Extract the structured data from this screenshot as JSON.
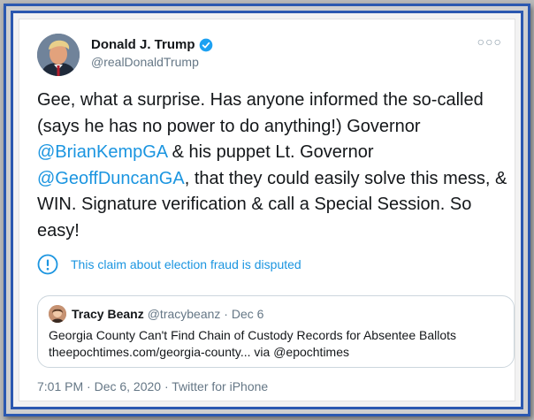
{
  "tweet": {
    "author_name": "Donald J. Trump",
    "author_handle": "@realDonaldTrump",
    "text_parts": {
      "p1": "Gee, what a surprise. Has anyone informed the so-called (says he has no power to do anything!) Governor ",
      "m1": "@BrianKempGA",
      "p2": " & his puppet Lt. Governor ",
      "m2": "@GeoffDuncanGA",
      "p3": ", that they could easily solve this mess, & WIN. Signature verification & call a Special Session. So easy!"
    },
    "dispute_label": "This claim about election fraud is disputed",
    "quote": {
      "name": "Tracy Beanz",
      "meta": "@tracybeanz · Dec 6",
      "line1": "Georgia County Can't Find Chain of Custody Records for Absentee Ballots",
      "line2": "theepochtimes.com/georgia-county... via @epochtimes"
    },
    "footer": {
      "timestamp": "7:01 PM · Dec 6, 2020 · ",
      "source": "Twitter for iPhone"
    }
  },
  "icons": {
    "verified": "verified-badge-icon",
    "dispute": "info-circle-icon",
    "more": "more-options-icon"
  },
  "colors": {
    "frame_border": "#2b58b0",
    "link": "#1b95e0",
    "text": "#14171a",
    "muted": "#657786"
  }
}
